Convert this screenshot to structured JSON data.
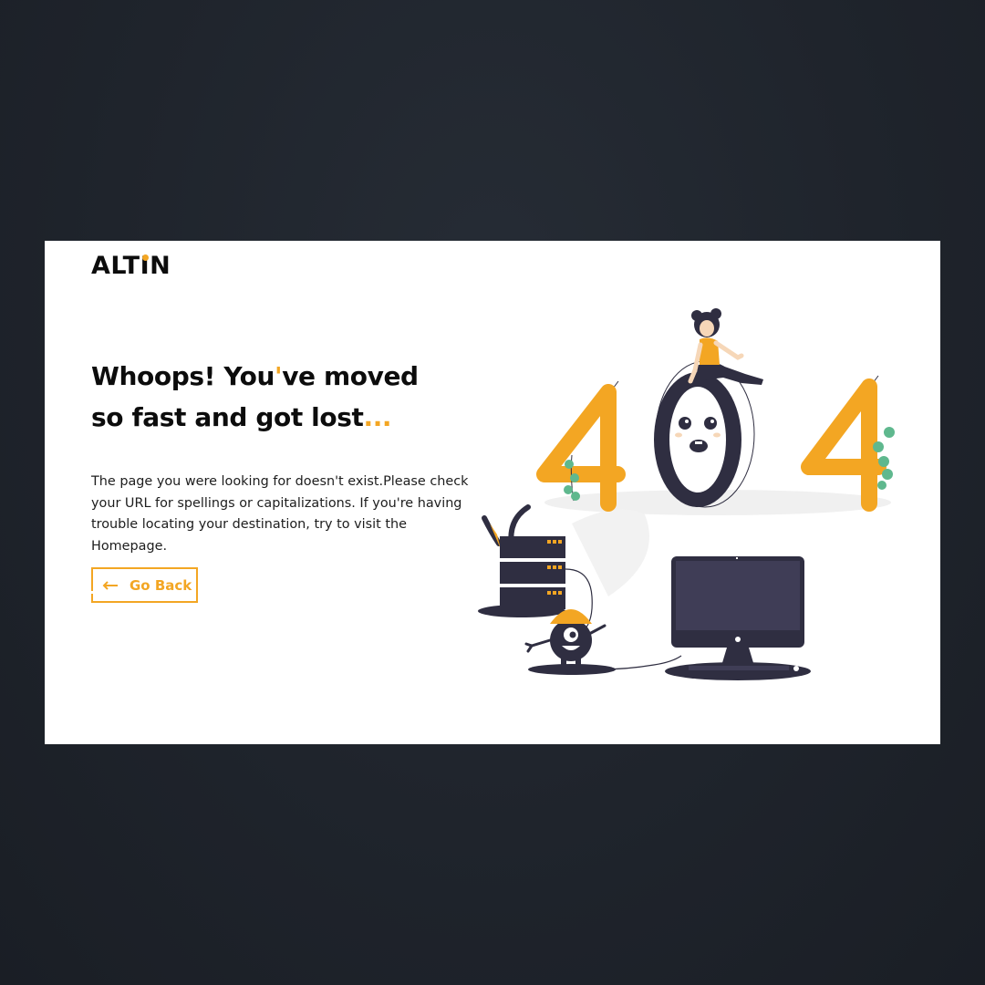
{
  "brand": {
    "logo_prefix": "ALT",
    "logo_i": "I",
    "logo_suffix": "N"
  },
  "hero": {
    "headline_part1": "Whoops! You",
    "headline_apostrophe": "'",
    "headline_part2": "ve moved",
    "headline_line2": "so fast and got lost",
    "headline_ellipsis": "...",
    "description": "The page you were looking for doesn't exist.Please check your URL for spellings or capitalizations. If you're having trouble locating your destination, try to visit the Homepage."
  },
  "actions": {
    "go_back_label": "Go Back",
    "go_back_icon": "arrow-left-icon"
  },
  "illustration": {
    "digits": "404",
    "subject": "404-illustration"
  },
  "colors": {
    "page_background": "#222831",
    "card_background": "#ffffff",
    "accent": "#f3a623",
    "text": "#0c0c0c",
    "dark_figure": "#2f2e41",
    "plant": "#5fb88e"
  }
}
